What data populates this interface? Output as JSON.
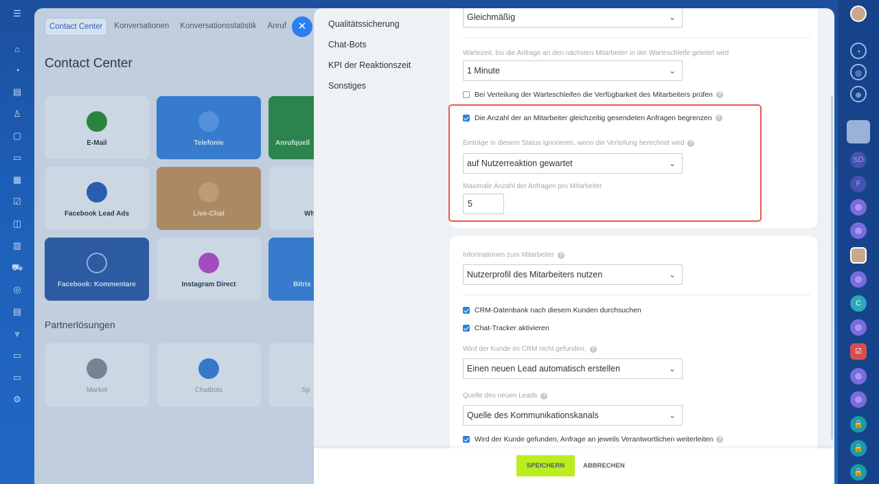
{
  "background": {
    "tabs": [
      "Contact Center",
      "Konversationen",
      "Konversationsstatistik",
      "Anruf"
    ],
    "title": "Contact Center",
    "tiles": [
      {
        "label": "E-Mail"
      },
      {
        "label": "Telefonie"
      },
      {
        "label": "Anrufquell"
      },
      {
        "label": "Facebook Lead Ads"
      },
      {
        "label": "Live-Chat"
      },
      {
        "label": "Wh"
      },
      {
        "label": "Facebook: Kommentare"
      },
      {
        "label": "Instagram Direct"
      },
      {
        "label": "Bitrix"
      },
      {
        "label": "Market"
      },
      {
        "label": "Chatbots"
      },
      {
        "label": "Sp"
      }
    ],
    "partner_heading": "Partnerlösungen"
  },
  "menu": [
    "Qualitätssicherung",
    "Chat-Bots",
    "KPI der Reaktionszeit",
    "Sonstiges"
  ],
  "settings": {
    "distribution_value": "Gleichmäßig",
    "wait_label": "Wartezeit, bis die Anfrage an den nächsten Mitarbeiter in der Warteschleife geleitet wird",
    "wait_value": "1 Minute",
    "check_availability": "Bei Verteilung der Warteschleifen die Verfügbarkeit des Mitarbeiters prüfen",
    "limit_requests": "Die Anzahl der an Mitarbeiter gleichzeitig gesendeten Anfragen begrenzen",
    "ignore_label": "Einträge in diesem Status ignorieren, wenn die Verteilung berechnet wird",
    "ignore_value": "auf Nutzerreaktion gewartet",
    "max_label": "Maximale Anzahl der Anfragen pro Mitarbeiter",
    "max_value": "5",
    "info_label": "Informationen zum Mitarbeiter",
    "info_value": "Nutzerprofil des Mitarbeiters nutzen",
    "crm_search": "CRM-Datenbank nach diesem Kunden durchsuchen",
    "chat_tracker": "Chat-Tracker aktivieren",
    "not_found_label": "Wird der Kunde im CRM nicht gefunden,",
    "not_found_value": "Einen neuen Lead automatisch erstellen",
    "source_label": "Quelle des neuen Leads",
    "source_value": "Quelle des Kommunikationskanals",
    "forward": "Wird der Kunde gefunden, Anfrage an jeweils Verantwortlichen weiterleiten"
  },
  "footer": {
    "save": "SPEICHERN",
    "cancel": "ABBRECHEN"
  },
  "right_rail": {
    "initials_sd": "SD",
    "initials_f": "F",
    "initials_c": "C"
  },
  "colors": {
    "accent": "#2f7fe0",
    "save_button": "#bbed21",
    "highlight": "#e8584d"
  }
}
